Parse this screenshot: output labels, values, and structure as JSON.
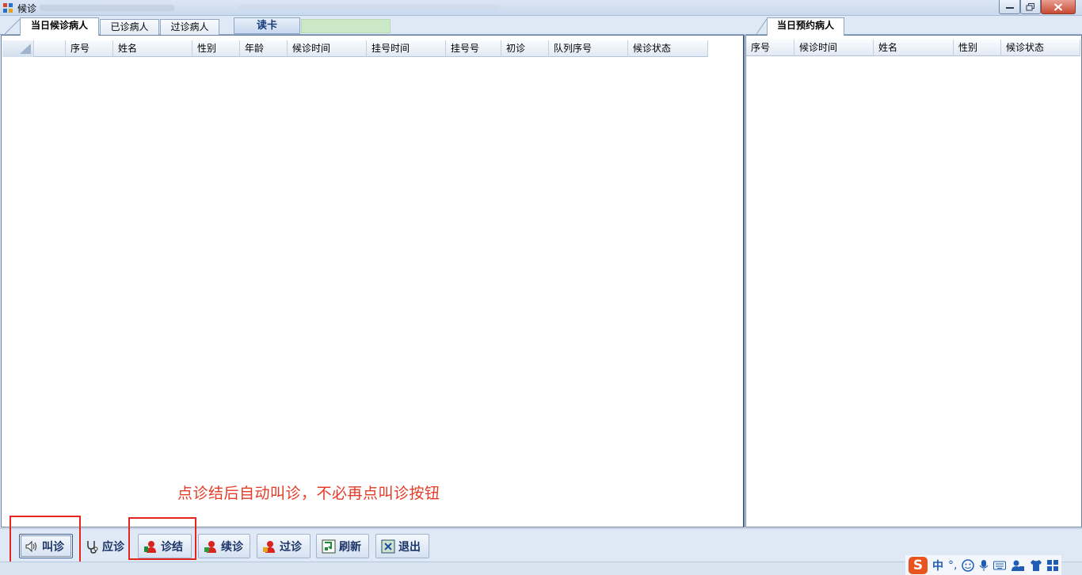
{
  "window": {
    "title": "候诊"
  },
  "left_tabs": [
    {
      "label": "当日候诊病人",
      "active": true
    },
    {
      "label": "已诊病人",
      "active": false
    },
    {
      "label": "过诊病人",
      "active": false
    }
  ],
  "read_card": {
    "label": "读卡",
    "field_value": "",
    "field_color": "#cbe9c7"
  },
  "right_tabs": [
    {
      "label": "当日预约病人",
      "active": true
    }
  ],
  "left_grid": {
    "columns": [
      "",
      "序号",
      "姓名",
      "性别",
      "年龄",
      "候诊时间",
      "挂号时间",
      "挂号号",
      "初诊",
      "队列序号",
      "候诊状态"
    ],
    "rows": []
  },
  "right_grid": {
    "columns": [
      "序号",
      "候诊时间",
      "姓名",
      "性别",
      "候诊状态"
    ],
    "rows": []
  },
  "annotation": {
    "text": "点诊结后自动叫诊，不必再点叫诊按钮",
    "color": "#e53a26"
  },
  "toolbar": {
    "buttons": [
      {
        "label": "叫诊",
        "icon": "speaker-icon",
        "highlighted": true
      },
      {
        "label": "应诊",
        "icon": "stethoscope-icon",
        "highlighted": false
      },
      {
        "label": "诊结",
        "icon": "patient-done-icon",
        "highlighted": true
      },
      {
        "label": "续诊",
        "icon": "patient-continue-icon",
        "highlighted": false
      },
      {
        "label": "过诊",
        "icon": "patient-skip-icon",
        "highlighted": false
      },
      {
        "label": "刷新",
        "icon": "refresh-icon",
        "highlighted": false
      },
      {
        "label": "退出",
        "icon": "exit-icon",
        "highlighted": false
      }
    ]
  },
  "ime": {
    "logo": "S",
    "mode": "中",
    "punct": "°,"
  }
}
